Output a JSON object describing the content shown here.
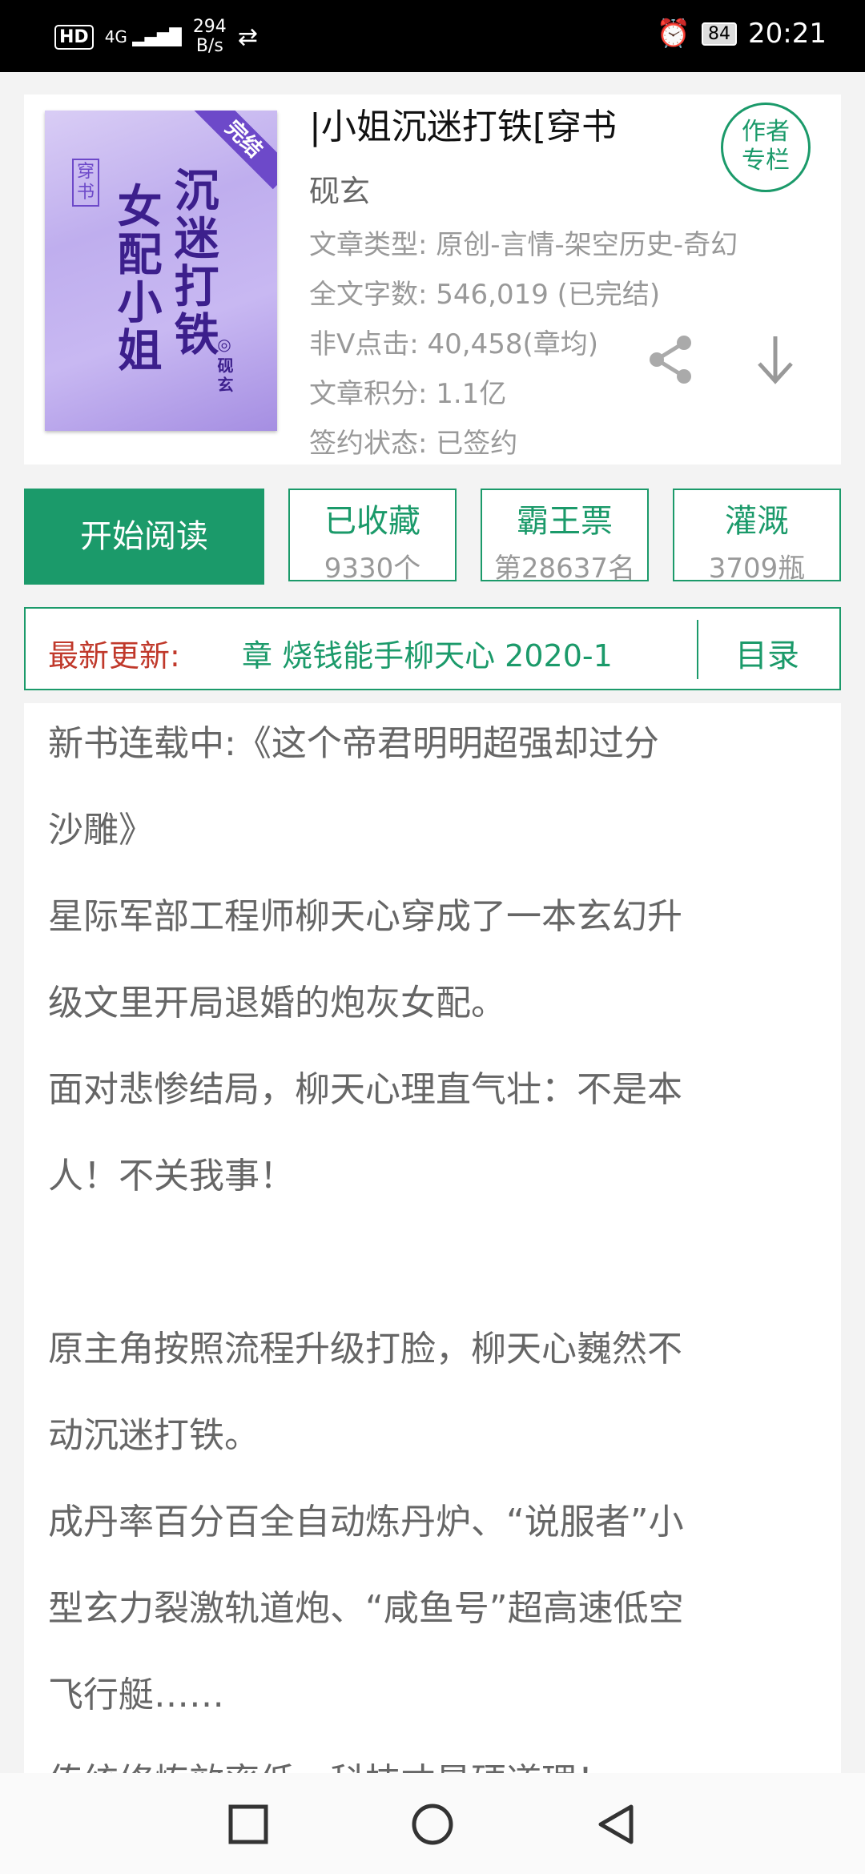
{
  "status_bar": {
    "hd": "HD",
    "signal": "4G",
    "speed_value": "294",
    "speed_unit": "B/s",
    "battery": "84",
    "time": "20:21"
  },
  "book": {
    "title": "|小姐沉迷打铁[穿书",
    "author": "砚玄",
    "author_column_line1": "作者",
    "author_column_line2": "专栏",
    "info": {
      "type": "文章类型: 原创-言情-架空历史-奇幻",
      "words": "全文字数: 546,019 (已完结)",
      "clicks": "非V点击: 40,458(章均)",
      "score": "文章积分: 1.1亿",
      "sign": "签约状态:  已签约"
    },
    "cover": {
      "ribbon": "完结",
      "tag": "穿书",
      "title_left": "女配小姐",
      "title_right": "沉迷打铁",
      "author": "◎砚玄"
    }
  },
  "actions": {
    "start": "开始阅读",
    "collect": {
      "label": "已收藏",
      "sub": "9330个"
    },
    "ticket": {
      "label": "霸王票",
      "sub": "第28637名"
    },
    "irrigate": {
      "label": "灌溉",
      "sub": "3709瓶"
    }
  },
  "latest": {
    "label": "最新更新:",
    "text": "章  烧钱能手柳天心  2020-1",
    "toc": "目录"
  },
  "description": {
    "lines": [
      "新书连载中:《这个帝君明明超强却过分",
      "沙雕》",
      "星际军部工程师柳天心穿成了一本玄幻升",
      "级文里开局退婚的炮灰女配。",
      "面对悲惨结局，柳天心理直气壮：不是本",
      "人！不关我事！",
      "",
      "原主角按照流程升级打脸，柳天心巍然不",
      "动沉迷打铁。",
      "成丹率百分百全自动炼丹炉、“说服者”小",
      "型玄力裂激轨道炮、“咸鱼号”超高速低空",
      "飞行艇……",
      "传统修炼效率低，科技才是硬道理！"
    ]
  }
}
